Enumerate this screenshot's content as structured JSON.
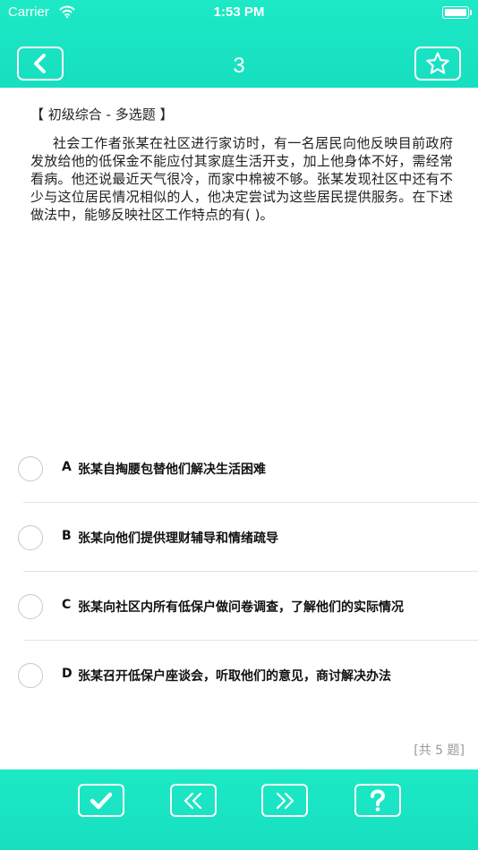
{
  "status_bar": {
    "carrier": "Carrier",
    "time": "1:53 PM"
  },
  "header": {
    "title": "3",
    "back_icon": "chevron-left-icon",
    "favorite_icon": "star-outline-icon"
  },
  "question": {
    "category": "【 初级综合 - 多选题 】",
    "text": "社会工作者张某在社区进行家访时，有一名居民向他反映目前政府发放给他的低保金不能应付其家庭生活开支，加上他身体不好，需经常看病。他还说最近天气很冷，而家中棉被不够。张某发现社区中还有不少与这位居民情况相似的人，他决定尝试为这些居民提供服务。在下述做法中，能够反映社区工作特点的有( )。"
  },
  "options": [
    {
      "letter": "A",
      "text": "张某自掏腰包替他们解决生活困难"
    },
    {
      "letter": "B",
      "text": "张某向他们提供理财辅导和情绪疏导"
    },
    {
      "letter": "C",
      "text": "张某向社区内所有低保户做问卷调查，了解他们的实际情况"
    },
    {
      "letter": "D",
      "text": "张某召开低保户座谈会，听取他们的意见，商讨解决办法"
    }
  ],
  "total_label": "[共 5 题]",
  "toolbar": {
    "submit_icon": "checkmark-icon",
    "previous_icon": "double-chevron-left-icon",
    "next_icon": "double-chevron-right-icon",
    "help_icon": "question-mark-icon"
  },
  "colors": {
    "accent": "#1de9c6",
    "text": "#222222",
    "muted": "#999999"
  }
}
